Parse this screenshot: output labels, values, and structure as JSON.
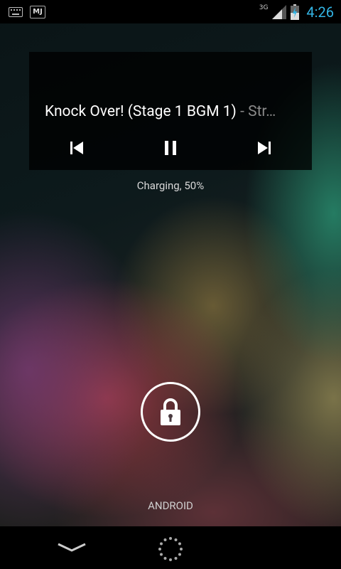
{
  "status_bar": {
    "left_icons": [
      "keyboard-icon",
      "mj-app-icon"
    ],
    "mj_label": "MJ",
    "network_type": "3G",
    "battery_level": 0.5,
    "battery_charging": true,
    "time": "4:26",
    "clock_color": "#33b5e5"
  },
  "music_widget": {
    "track_title": "Knock Over! (Stage 1 BGM 1)",
    "track_artist": " - Str…",
    "controls": [
      "previous-icon",
      "pause-icon",
      "next-icon"
    ]
  },
  "lockscreen": {
    "charging_status": "Charging, 50%",
    "unlock_icon": "lock-icon",
    "carrier": "ANDROID"
  },
  "nav_bar": {
    "icons": [
      "chevron-down-icon",
      "spinner-icon"
    ]
  }
}
